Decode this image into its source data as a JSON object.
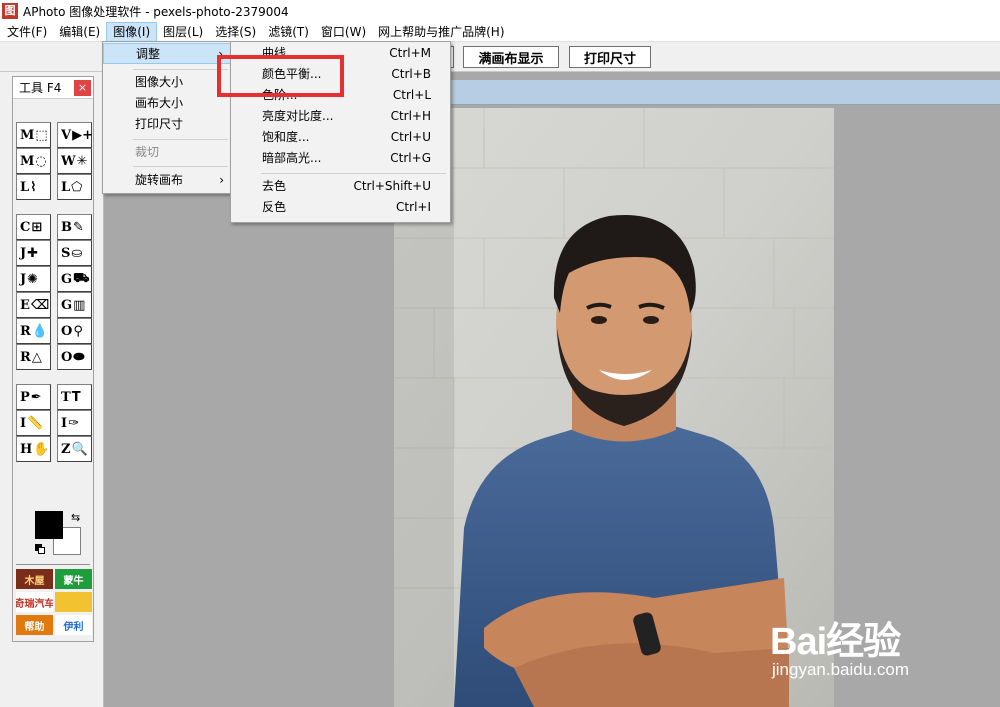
{
  "window": {
    "title": "APhoto 图像处理软件 - pexels-photo-2379004"
  },
  "menubar": [
    {
      "label": "文件(F)"
    },
    {
      "label": "编辑(E)"
    },
    {
      "label": "图像(I)"
    },
    {
      "label": "图层(L)"
    },
    {
      "label": "选择(S)"
    },
    {
      "label": "滤镜(T)"
    },
    {
      "label": "窗口(W)"
    },
    {
      "label": "网上帮助与推广品牌(H)"
    }
  ],
  "toolbar": {
    "fit_label": "满画布显示",
    "print_size_label": "打印尺寸"
  },
  "tools_panel": {
    "title": "工具 F4",
    "close": "×"
  },
  "tools": [
    {
      "key": "M",
      "icon": "rect-marquee-icon",
      "glyph": "⬚"
    },
    {
      "key": "V",
      "icon": "move-icon",
      "glyph": "▶+"
    },
    {
      "key": "M",
      "icon": "ellipse-marquee-icon",
      "glyph": "◌"
    },
    {
      "key": "W",
      "icon": "magic-wand-icon",
      "glyph": "✳"
    },
    {
      "key": "L",
      "icon": "lasso-icon",
      "glyph": "⌇"
    },
    {
      "key": "L",
      "icon": "polygon-lasso-icon",
      "glyph": "⬠"
    },
    {
      "key": "C",
      "icon": "crop-icon",
      "glyph": "⊞"
    },
    {
      "key": "B",
      "icon": "brush-icon",
      "glyph": "✎"
    },
    {
      "key": "J",
      "icon": "healing-icon",
      "glyph": "✚"
    },
    {
      "key": "S",
      "icon": "stamp-icon",
      "glyph": "⛀"
    },
    {
      "key": "J",
      "icon": "spot-heal-icon",
      "glyph": "✺"
    },
    {
      "key": "G",
      "icon": "paint-bucket-icon",
      "glyph": "⛟"
    },
    {
      "key": "E",
      "icon": "eraser-icon",
      "glyph": "⌫"
    },
    {
      "key": "G",
      "icon": "gradient-icon",
      "glyph": "▥"
    },
    {
      "key": "R",
      "icon": "blur-icon",
      "glyph": "💧"
    },
    {
      "key": "O",
      "icon": "dodge-icon",
      "glyph": "⚲"
    },
    {
      "key": "R",
      "icon": "sharpen-icon",
      "glyph": "△"
    },
    {
      "key": "O",
      "icon": "sponge-icon",
      "glyph": "⬬"
    },
    {
      "key": "P",
      "icon": "pen-icon",
      "glyph": "✒"
    },
    {
      "key": "T",
      "icon": "text-icon",
      "glyph": "T"
    },
    {
      "key": "I",
      "icon": "ruler-icon",
      "glyph": "📏"
    },
    {
      "key": "I",
      "icon": "eyedropper-icon",
      "glyph": "✑"
    },
    {
      "key": "H",
      "icon": "hand-icon",
      "glyph": "✋"
    },
    {
      "key": "Z",
      "icon": "zoom-icon",
      "glyph": "🔍"
    }
  ],
  "colors": {
    "foreground": "#000000",
    "background": "#ffffff"
  },
  "banners": [
    {
      "text": "木屋",
      "bg": "#7a2e1a",
      "fg": "#ffd27a"
    },
    {
      "text": "蒙牛",
      "bg": "#1e9e3a",
      "fg": "#ffffff"
    },
    {
      "text": "奇瑞汽车",
      "bg": "#ffffff",
      "fg": "#c0392b"
    },
    {
      "text": "",
      "bg": "#f2c230",
      "fg": "#000000"
    },
    {
      "text": "帮助",
      "bg": "#e07a10",
      "fg": "#ffffff"
    },
    {
      "text": "伊利",
      "bg": "#ffffff",
      "fg": "#1c6fd1"
    }
  ],
  "image_menu": [
    {
      "label": "调整",
      "has_submenu": true,
      "highlight": true
    },
    {
      "label": "图像大小"
    },
    {
      "label": "画布大小"
    },
    {
      "label": "打印尺寸"
    },
    {
      "label": "裁切",
      "disabled": true
    },
    {
      "label": "旋转画布",
      "has_submenu": true
    }
  ],
  "adjust_submenu": [
    {
      "label": "曲线",
      "shortcut": "Ctrl+M"
    },
    {
      "label": "颜色平衡...",
      "shortcut": "Ctrl+B"
    },
    {
      "label": "色阶...",
      "shortcut": "Ctrl+L"
    },
    {
      "label": "亮度对比度...",
      "shortcut": "Ctrl+H"
    },
    {
      "label": "饱和度...",
      "shortcut": "Ctrl+U"
    },
    {
      "label": "暗部高光...",
      "shortcut": "Ctrl+G"
    },
    {
      "label": "去色",
      "shortcut": "Ctrl+Shift+U"
    },
    {
      "label": "反色",
      "shortcut": "Ctrl+I"
    }
  ],
  "watermark": {
    "main": "Bai经验",
    "sub": "jingyan.baidu.com"
  },
  "accent_colors": {
    "menu_highlight": "#cce4f7",
    "annotation_red": "#e63030",
    "shirt_blue": "#3f5f8f"
  }
}
